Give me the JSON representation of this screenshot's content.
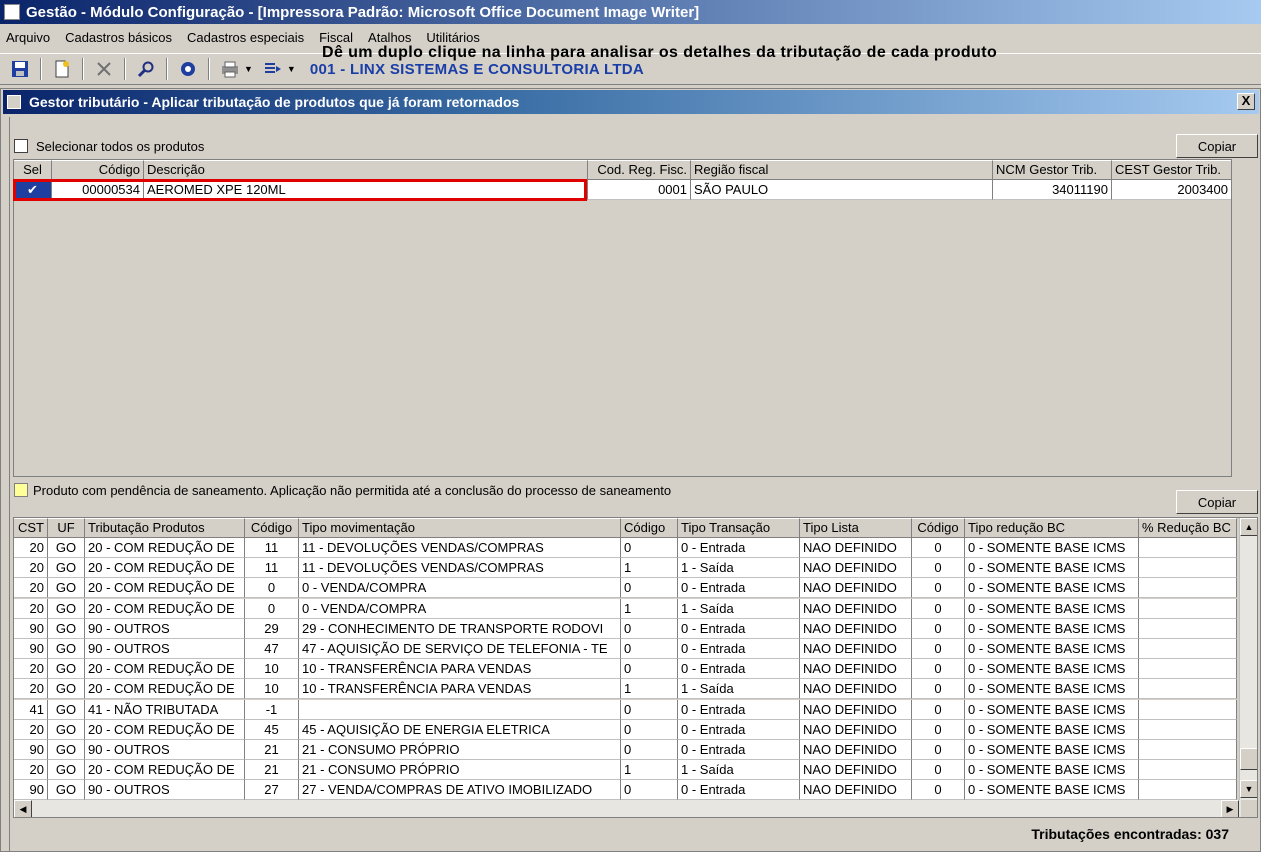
{
  "window": {
    "title": "Gestão  - Módulo Configuração - [Impressora Padrão: Microsoft Office Document Image Writer]"
  },
  "menu": [
    "Arquivo",
    "Cadastros básicos",
    "Cadastros especiais",
    "Fiscal",
    "Atalhos",
    "Utilitários"
  ],
  "toolbar": {
    "company": "001 - LINX SISTEMAS E CONSULTORIA LTDA"
  },
  "dialog": {
    "title": "Gestor tributário - Aplicar tributação de produtos que já foram retornados",
    "close": "X",
    "select_all_label": "Selecionar todos os produtos",
    "instruction": "Dê um duplo clique na linha para analisar os detalhes da tributação de cada produto",
    "copy_label": "Copiar",
    "legend_text": "Produto com pendência de saneamento. Aplicação não permitida até a conclusão do processo de saneamento",
    "status": "Tributações encontradas: 037"
  },
  "products": {
    "columns": [
      "Sel",
      "Código",
      "Descrição",
      "Cod. Reg. Fisc.",
      "Região fiscal",
      "NCM Gestor Trib.",
      "CEST Gestor Trib."
    ],
    "rows": [
      {
        "sel": "✔",
        "codigo": "00000534",
        "descricao": "AEROMED XPE 120ML",
        "cod_reg": "0001",
        "regiao": "SÃO PAULO",
        "ncm": "34011190",
        "cest": "2003400"
      }
    ]
  },
  "tributacoes": {
    "columns": [
      "CST",
      "UF",
      "Tributação Produtos",
      "Código",
      "Tipo movimentação",
      "Código",
      "Tipo Transação",
      "Tipo Lista",
      "Código",
      "Tipo redução BC",
      "% Redução BC"
    ],
    "rows": [
      [
        "20",
        "GO",
        "20 - COM REDUÇÃO DE",
        "11",
        "11 - DEVOLUÇÕES VENDAS/COMPRAS",
        "0",
        "0 - Entrada",
        "NAO DEFINIDO",
        "0",
        "0 - SOMENTE BASE ICMS",
        ""
      ],
      [
        "20",
        "GO",
        "20 - COM REDUÇÃO DE",
        "11",
        "11 - DEVOLUÇÕES VENDAS/COMPRAS",
        "1",
        "1 - Saída",
        "NAO DEFINIDO",
        "0",
        "0 - SOMENTE BASE ICMS",
        ""
      ],
      [
        "20",
        "GO",
        "20 - COM REDUÇÃO DE",
        "0",
        "0   - VENDA/COMPRA",
        "0",
        "0 - Entrada",
        "NAO DEFINIDO",
        "0",
        "0 - SOMENTE BASE ICMS",
        ""
      ],
      [
        "20",
        "GO",
        "20 - COM REDUÇÃO DE",
        "0",
        "0   - VENDA/COMPRA",
        "1",
        "1 - Saída",
        "NAO DEFINIDO",
        "0",
        "0 - SOMENTE BASE ICMS",
        ""
      ],
      [
        "90",
        "GO",
        "90 - OUTROS",
        "29",
        "29 - CONHECIMENTO DE TRANSPORTE RODOVI",
        "0",
        "0 - Entrada",
        "NAO DEFINIDO",
        "0",
        "0 - SOMENTE BASE ICMS",
        ""
      ],
      [
        "90",
        "GO",
        "90 - OUTROS",
        "47",
        "47 - AQUISIÇÃO DE SERVIÇO DE TELEFONIA - TE",
        "0",
        "0 - Entrada",
        "NAO DEFINIDO",
        "0",
        "0 - SOMENTE BASE ICMS",
        ""
      ],
      [
        "20",
        "GO",
        "20 - COM REDUÇÃO DE",
        "10",
        "10 - TRANSFERÊNCIA PARA VENDAS",
        "0",
        "0 - Entrada",
        "NAO DEFINIDO",
        "0",
        "0 - SOMENTE BASE ICMS",
        ""
      ],
      [
        "20",
        "GO",
        "20 - COM REDUÇÃO DE",
        "10",
        "10 - TRANSFERÊNCIA PARA VENDAS",
        "1",
        "1 - Saída",
        "NAO DEFINIDO",
        "0",
        "0 - SOMENTE BASE ICMS",
        ""
      ],
      [
        "41",
        "GO",
        "41 - NÃO TRIBUTADA",
        "-1",
        "",
        "0",
        "0 - Entrada",
        "NAO DEFINIDO",
        "0",
        "0 - SOMENTE BASE ICMS",
        ""
      ],
      [
        "20",
        "GO",
        "20 - COM REDUÇÃO DE",
        "45",
        "45 - AQUISIÇÃO DE ENERGIA ELETRICA",
        "0",
        "0 - Entrada",
        "NAO DEFINIDO",
        "0",
        "0 - SOMENTE BASE ICMS",
        ""
      ],
      [
        "90",
        "GO",
        "90 - OUTROS",
        "21",
        "21 - CONSUMO PRÓPRIO",
        "0",
        "0 - Entrada",
        "NAO DEFINIDO",
        "0",
        "0 - SOMENTE BASE ICMS",
        ""
      ],
      [
        "20",
        "GO",
        "20 - COM REDUÇÃO DE",
        "21",
        "21 - CONSUMO PRÓPRIO",
        "1",
        "1 - Saída",
        "NAO DEFINIDO",
        "0",
        "0 - SOMENTE BASE ICMS",
        ""
      ],
      [
        "90",
        "GO",
        "90 - OUTROS",
        "27",
        "27 - VENDA/COMPRAS DE ATIVO IMOBILIZADO",
        "0",
        "0 - Entrada",
        "NAO DEFINIDO",
        "0",
        "0 - SOMENTE BASE ICMS",
        ""
      ]
    ]
  }
}
